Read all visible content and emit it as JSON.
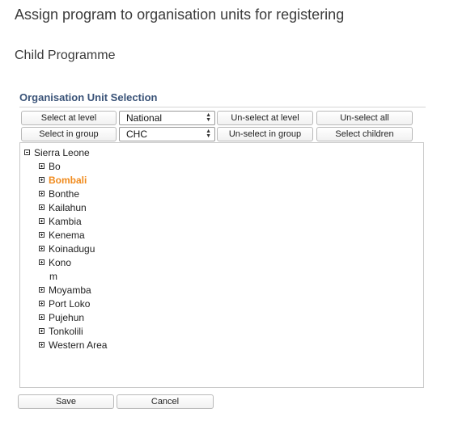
{
  "header": {
    "title": "Assign program to organisation units for registering",
    "program": "Child Programme"
  },
  "section": {
    "title": "Organisation Unit Selection"
  },
  "controls": {
    "select_at_level": "Select at level",
    "level_value": "National",
    "unselect_at_level": "Un-select at level",
    "unselect_all": "Un-select all",
    "select_in_group": "Select in group",
    "group_value": "CHC",
    "unselect_in_group": "Un-select in group",
    "select_children": "Select children"
  },
  "tree": {
    "root": {
      "label": "Sierra Leone",
      "expanded": true
    },
    "children": [
      {
        "label": "Bo",
        "selected": false
      },
      {
        "label": "Bombali",
        "selected": true
      },
      {
        "label": "Bonthe",
        "selected": false
      },
      {
        "label": "Kailahun",
        "selected": false
      },
      {
        "label": "Kambia",
        "selected": false
      },
      {
        "label": "Kenema",
        "selected": false
      },
      {
        "label": "Koinadugu",
        "selected": false
      },
      {
        "label": "Kono",
        "selected": false
      },
      {
        "label": "m",
        "selected": false,
        "leaf": true
      },
      {
        "label": "Moyamba",
        "selected": false
      },
      {
        "label": "Port Loko",
        "selected": false
      },
      {
        "label": "Pujehun",
        "selected": false
      },
      {
        "label": "Tonkolili",
        "selected": false
      },
      {
        "label": "Western Area",
        "selected": false
      }
    ],
    "selected_color": "#f08a1c"
  },
  "footer": {
    "save": "Save",
    "cancel": "Cancel"
  }
}
